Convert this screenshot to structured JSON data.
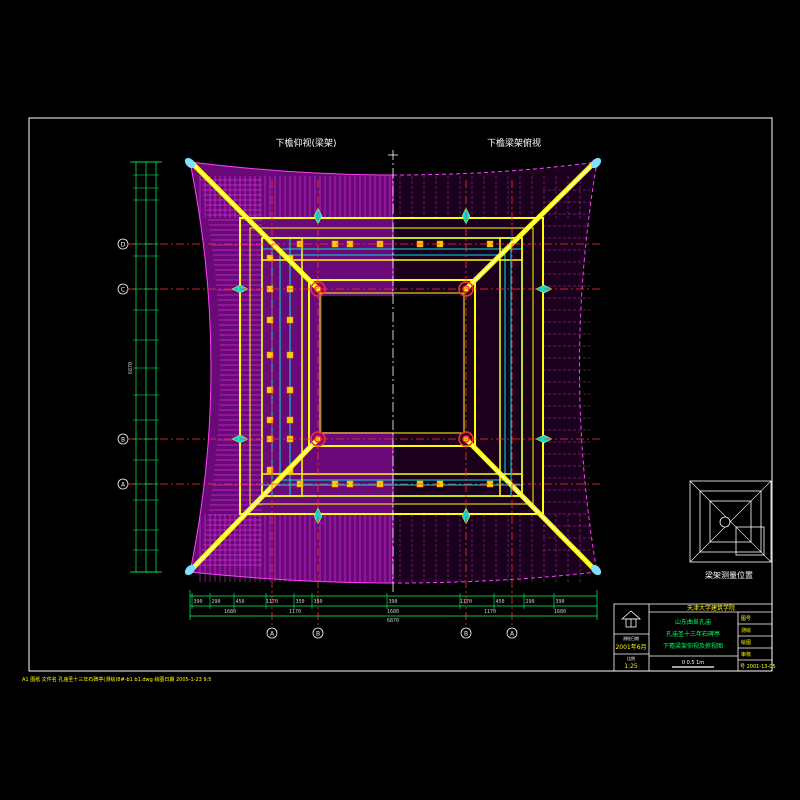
{
  "titles": {
    "left_view": "下檐仰视(梁架)",
    "right_view": "下檐梁架俯视"
  },
  "grid_labels": {
    "rows": [
      "D",
      "C",
      "B",
      "A"
    ],
    "cols": [
      "A",
      "B",
      "B",
      "A"
    ]
  },
  "dims": {
    "bottom_row1": [
      "390",
      "290",
      "450",
      "1170",
      "350",
      "350",
      "390",
      "1170",
      "450",
      "290",
      "390"
    ],
    "bottom_row2": [
      "1680",
      "1170",
      "1680",
      "1170",
      "1680"
    ],
    "bottom_total": "6870",
    "left_total": "6870"
  },
  "key_plan": {
    "caption": "梁架测量位置"
  },
  "title_block": {
    "institute": "天津大学建筑学院",
    "project_line1": "山东曲阜孔庙",
    "project_line2": "孔庙圣十三年石碑亭",
    "drawing_name": "下檐梁架仰视及俯视图",
    "date_label": "测绘日期",
    "date_value": "2001年6月",
    "scale_label": "比例",
    "scale_value": "1:25",
    "scale_bar": "0    0.5    1m",
    "rows": [
      "图号",
      "测绘",
      "绘图",
      "审核",
      "号 2001-13-05"
    ]
  },
  "footer": {
    "text": "A1 图纸    文件名  孔庙圣十三年石碑亭(测绘)8#-b1 b1.dwg    绘图日期  2005-1-23 9:5"
  }
}
